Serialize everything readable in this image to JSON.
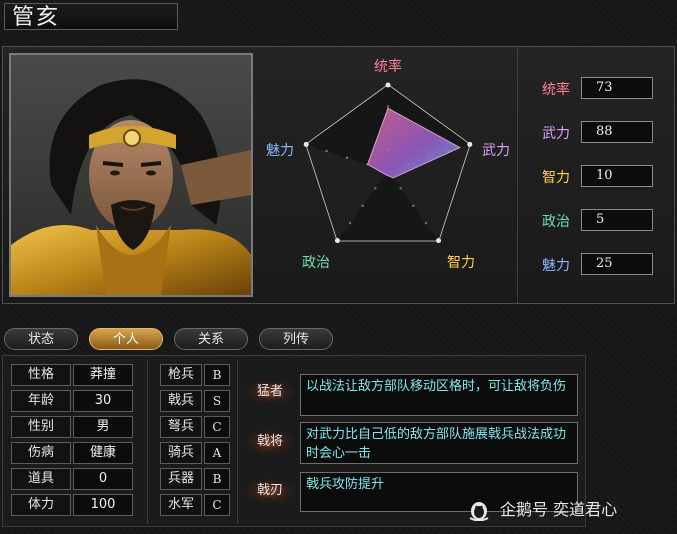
{
  "general": {
    "name": "管亥"
  },
  "radar": {
    "labels": [
      "统率",
      "武力",
      "智力",
      "政治",
      "魅力"
    ],
    "label_colors": [
      "#ff7f9a",
      "#d8a0ff",
      "#ffd34d",
      "#6fe0b0",
      "#8ab8ff"
    ],
    "max": 100
  },
  "stats": [
    {
      "label": "统率",
      "value": "73",
      "color": "#ff7f9a"
    },
    {
      "label": "武力",
      "value": "88",
      "color": "#d8a0ff"
    },
    {
      "label": "智力",
      "value": "10",
      "color": "#ffd34d"
    },
    {
      "label": "政治",
      "value": "5",
      "color": "#6fe0b0"
    },
    {
      "label": "魅力",
      "value": "25",
      "color": "#8ab8ff"
    }
  ],
  "tabs": [
    "状态",
    "个人",
    "关系",
    "列传"
  ],
  "active_tab": "个人",
  "info": [
    {
      "label": "性格",
      "value": "莽撞"
    },
    {
      "label": "年龄",
      "value": "30"
    },
    {
      "label": "性别",
      "value": "男"
    },
    {
      "label": "伤病",
      "value": "健康"
    },
    {
      "label": "道具",
      "value": "0"
    },
    {
      "label": "体力",
      "value": "100"
    }
  ],
  "troops": [
    {
      "label": "枪兵",
      "rank": "B"
    },
    {
      "label": "戟兵",
      "rank": "S"
    },
    {
      "label": "弩兵",
      "rank": "C"
    },
    {
      "label": "骑兵",
      "rank": "A"
    },
    {
      "label": "兵器",
      "rank": "B"
    },
    {
      "label": "水军",
      "rank": "C"
    }
  ],
  "skills": [
    {
      "name": "猛者",
      "desc": "以战法让敌方部队移动区格时，可让敌将负伤"
    },
    {
      "name": "戟将",
      "desc": "对武力比自己低的敌方部队施展戟兵战法成功时会心一击"
    },
    {
      "name": "戟刃",
      "desc": "戟兵攻防提升"
    }
  ],
  "watermark": {
    "text": "企鹅号 奕道君心",
    "icon": "penguin-icon"
  }
}
